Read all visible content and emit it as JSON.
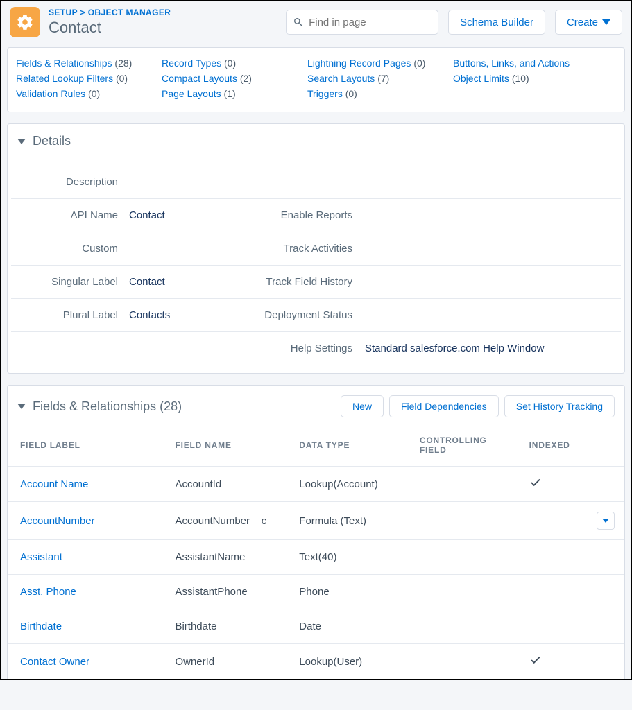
{
  "breadcrumb": {
    "setup": "SETUP",
    "sep": ">",
    "section": "OBJECT MANAGER"
  },
  "page_title": "Contact",
  "search": {
    "placeholder": "Find in page"
  },
  "header_buttons": {
    "schema": "Schema Builder",
    "create": "Create"
  },
  "tabs": {
    "col1": [
      {
        "label": "Fields & Relationships",
        "count": "(28)"
      },
      {
        "label": "Related Lookup Filters",
        "count": "(0)"
      },
      {
        "label": "Validation Rules",
        "count": "(0)"
      }
    ],
    "col2": [
      {
        "label": "Record Types",
        "count": "(0)"
      },
      {
        "label": "Compact Layouts",
        "count": "(2)"
      },
      {
        "label": "Page Layouts",
        "count": "(1)"
      }
    ],
    "col3": [
      {
        "label": "Lightning Record Pages",
        "count": "(0)"
      },
      {
        "label": "Search Layouts",
        "count": "(7)"
      },
      {
        "label": "Triggers",
        "count": "(0)"
      }
    ],
    "col4": [
      {
        "label": "Buttons, Links, and Actions",
        "count": ""
      },
      {
        "label": "Object Limits",
        "count": "(10)"
      }
    ]
  },
  "details": {
    "title": "Details",
    "rows": [
      {
        "l1": "Description",
        "v1": "",
        "l2": "",
        "v2": ""
      },
      {
        "l1": "API Name",
        "v1": "Contact",
        "l2": "Enable Reports",
        "v2": ""
      },
      {
        "l1": "Custom",
        "v1": "",
        "l2": "Track Activities",
        "v2": ""
      },
      {
        "l1": "Singular Label",
        "v1": "Contact",
        "l2": "Track Field History",
        "v2": ""
      },
      {
        "l1": "Plural Label",
        "v1": "Contacts",
        "l2": "Deployment Status",
        "v2": ""
      },
      {
        "l1": "",
        "v1": "",
        "l2": "Help Settings",
        "v2": "Standard salesforce.com Help Window"
      }
    ]
  },
  "fields_section": {
    "title": "Fields & Relationships",
    "count": "(28)",
    "buttons": {
      "new": "New",
      "deps": "Field Dependencies",
      "hist": "Set History Tracking"
    },
    "columns": {
      "label": "FIELD LABEL",
      "name": "FIELD NAME",
      "type": "DATA TYPE",
      "ctrl": "CONTROLLING FIELD",
      "indexed": "INDEXED"
    },
    "rows": [
      {
        "label": "Account Name",
        "name": "AccountId",
        "type": "Lookup(Account)",
        "ctrl": "",
        "indexed": true,
        "menu": false
      },
      {
        "label": "AccountNumber",
        "name": "AccountNumber__c",
        "type": "Formula (Text)",
        "ctrl": "",
        "indexed": false,
        "menu": true
      },
      {
        "label": "Assistant",
        "name": "AssistantName",
        "type": "Text(40)",
        "ctrl": "",
        "indexed": false,
        "menu": false
      },
      {
        "label": "Asst. Phone",
        "name": "AssistantPhone",
        "type": "Phone",
        "ctrl": "",
        "indexed": false,
        "menu": false
      },
      {
        "label": "Birthdate",
        "name": "Birthdate",
        "type": "Date",
        "ctrl": "",
        "indexed": false,
        "menu": false
      },
      {
        "label": "Contact Owner",
        "name": "OwnerId",
        "type": "Lookup(User)",
        "ctrl": "",
        "indexed": true,
        "menu": false
      }
    ]
  }
}
